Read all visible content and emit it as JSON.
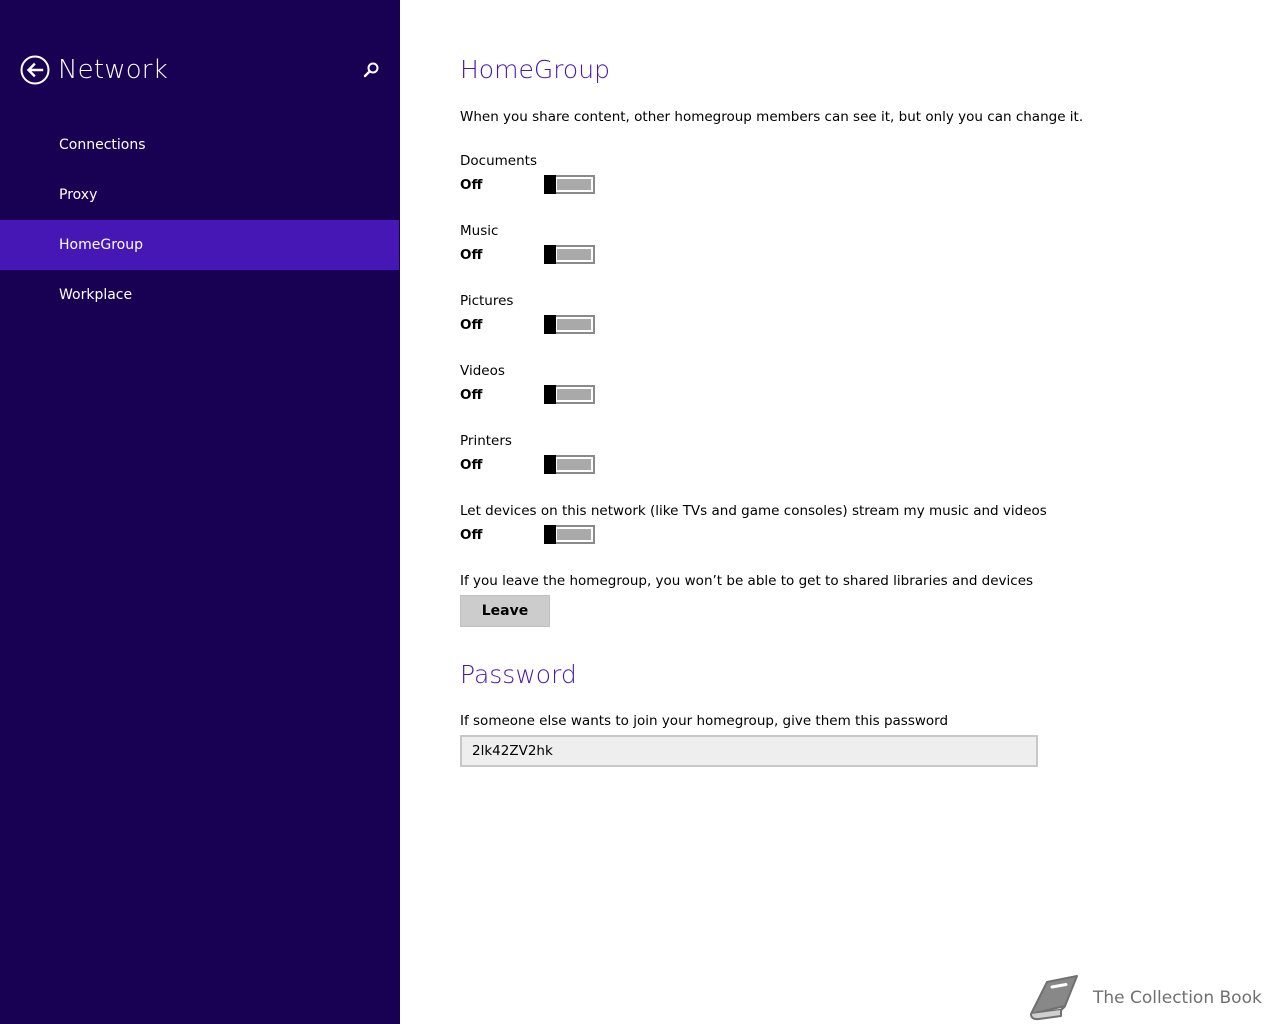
{
  "sidebar": {
    "title": "Network",
    "back_icon": "back-arrow-icon",
    "search_icon": "search-icon",
    "items": [
      {
        "label": "Connections",
        "active": false
      },
      {
        "label": "Proxy",
        "active": false
      },
      {
        "label": "HomeGroup",
        "active": true
      },
      {
        "label": "Workplace",
        "active": false
      }
    ]
  },
  "homegroup": {
    "heading": "HomeGroup",
    "description": "When you share content, other homegroup members can see it, but only you can change it.",
    "settings": [
      {
        "label": "Documents",
        "state": "Off"
      },
      {
        "label": "Music",
        "state": "Off"
      },
      {
        "label": "Pictures",
        "state": "Off"
      },
      {
        "label": "Videos",
        "state": "Off"
      },
      {
        "label": "Printers",
        "state": "Off"
      },
      {
        "label": "Let devices on this network (like TVs and game consoles) stream my music and videos",
        "state": "Off"
      }
    ],
    "leave_text": "If you leave the homegroup, you won’t be able to get to shared libraries and devices",
    "leave_button": "Leave"
  },
  "password": {
    "heading": "Password",
    "description": "If someone else wants to join your homegroup, give them this password",
    "value": "2lk42ZV2hk"
  },
  "watermark": {
    "text": "The Collection Book",
    "icon": "book-icon"
  },
  "colors": {
    "sidebar_bg": "#180052",
    "accent": "#4617b4",
    "toggle_off_fill": "#a9a9a9"
  }
}
